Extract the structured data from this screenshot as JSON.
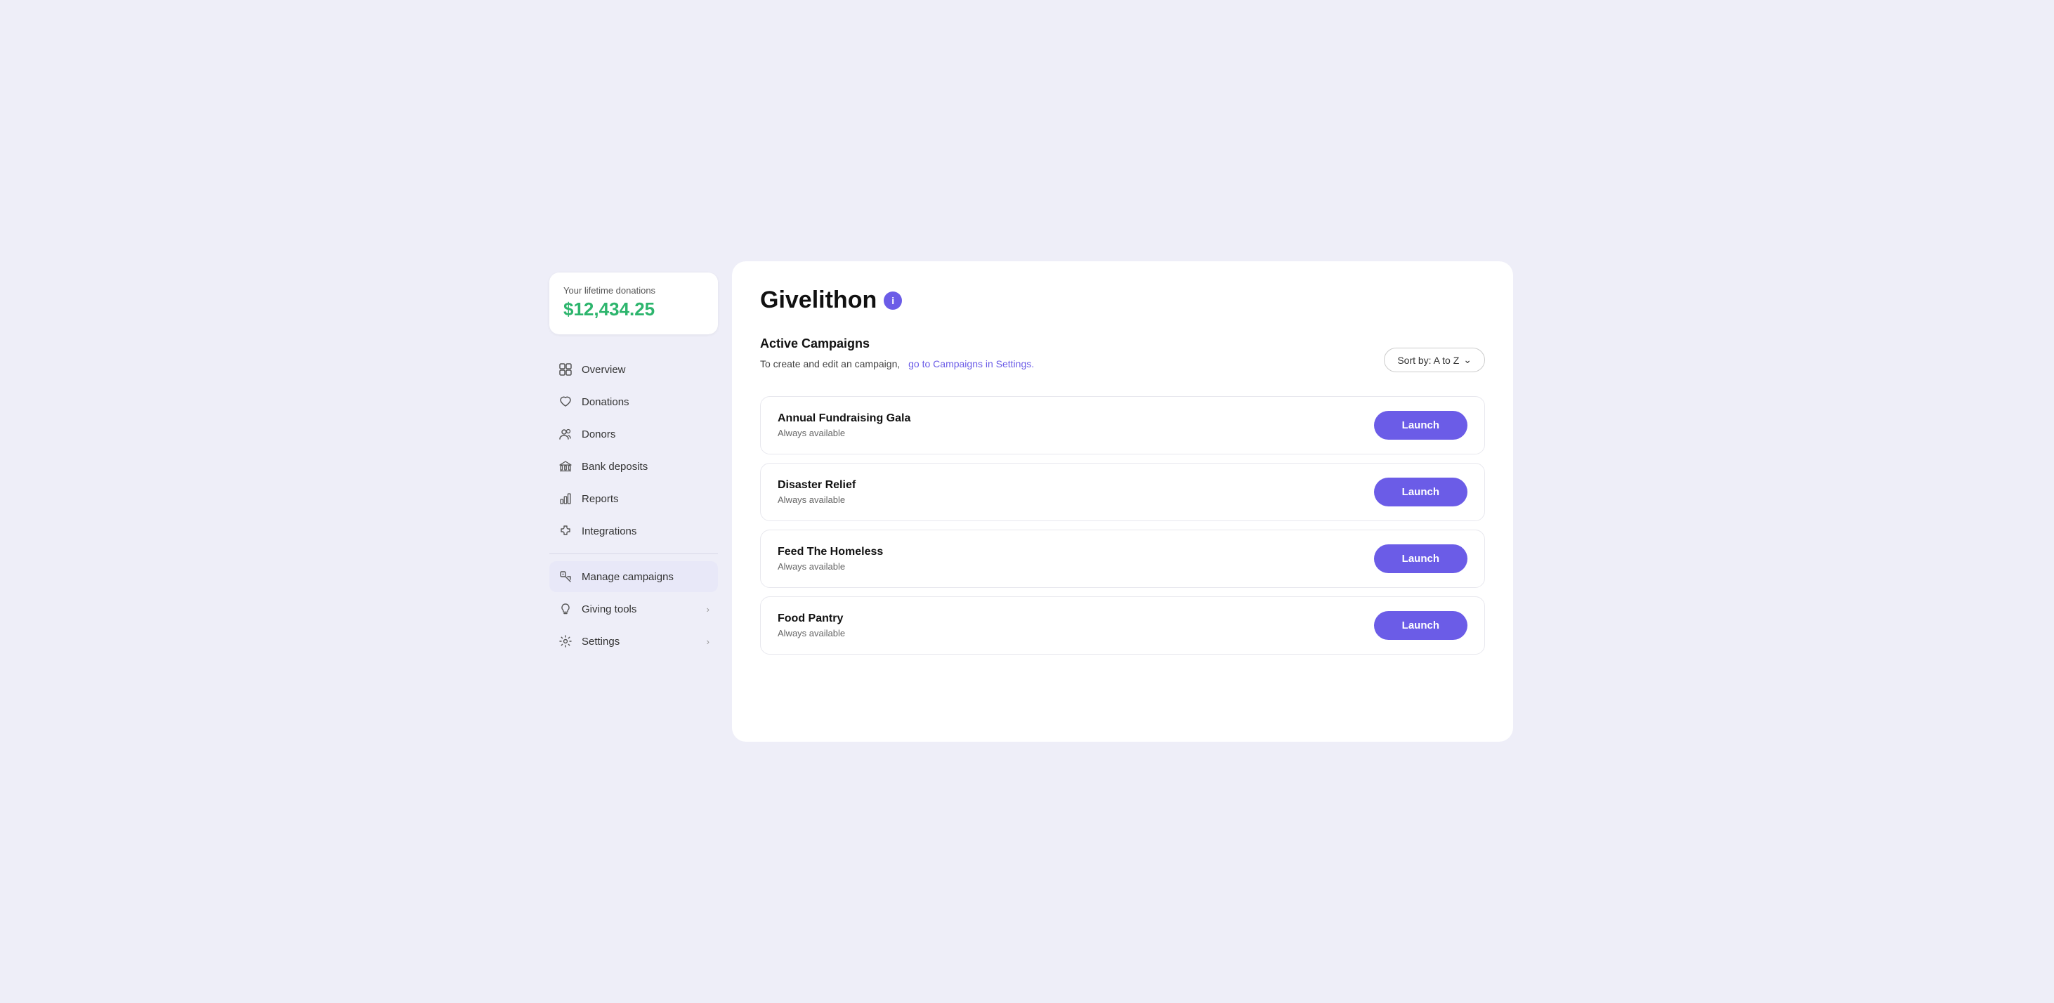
{
  "lifetime": {
    "label": "Your lifetime donations",
    "amount": "$12,434.25"
  },
  "nav": {
    "items": [
      {
        "id": "overview",
        "label": "Overview",
        "icon": "grid"
      },
      {
        "id": "donations",
        "label": "Donations",
        "icon": "heart"
      },
      {
        "id": "donors",
        "label": "Donors",
        "icon": "users"
      },
      {
        "id": "bank-deposits",
        "label": "Bank deposits",
        "icon": "bank"
      },
      {
        "id": "reports",
        "label": "Reports",
        "icon": "bar-chart"
      },
      {
        "id": "integrations",
        "label": "Integrations",
        "icon": "puzzle"
      }
    ],
    "items2": [
      {
        "id": "manage-campaigns",
        "label": "Manage campaigns",
        "icon": "tag"
      },
      {
        "id": "giving-tools",
        "label": "Giving tools",
        "icon": "lightbulb",
        "hasChevron": true
      },
      {
        "id": "settings",
        "label": "Settings",
        "icon": "gear",
        "hasChevron": true
      }
    ]
  },
  "page": {
    "title": "Givelithon",
    "info_tooltip": "i",
    "active_campaigns_label": "Active Campaigns",
    "subtitle_static": "To create and edit an campaign,",
    "subtitle_link": "go to Campaigns in Settings.",
    "sort_label": "Sort by: A to Z",
    "campaigns": [
      {
        "id": "c1",
        "name": "Annual Fundraising Gala",
        "availability": "Always available",
        "button": "Launch"
      },
      {
        "id": "c2",
        "name": "Disaster Relief",
        "availability": "Always available",
        "button": "Launch"
      },
      {
        "id": "c3",
        "name": "Feed The Homeless",
        "availability": "Always available",
        "button": "Launch"
      },
      {
        "id": "c4",
        "name": "Food Pantry",
        "availability": "Always available",
        "button": "Launch"
      }
    ]
  }
}
